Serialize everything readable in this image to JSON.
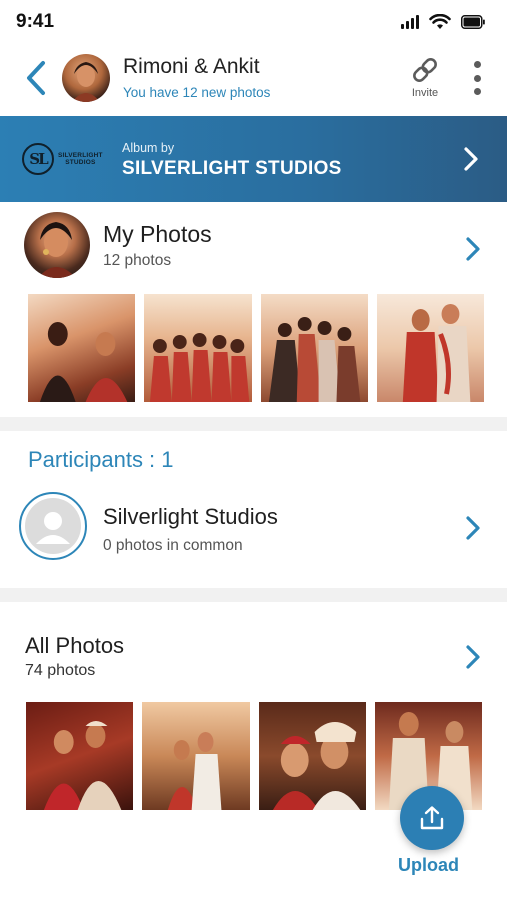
{
  "status_bar": {
    "time": "9:41"
  },
  "header": {
    "title": "Rimoni & Ankit",
    "subtitle": "You have 12 new photos",
    "invite_label": "Invite"
  },
  "album_banner": {
    "logo_text_line1": "SILVERLIGHT",
    "logo_text_line2": "STUDIOS",
    "album_by_label": "Album by",
    "studio_name": "SILVERLIGHT STUDIOS"
  },
  "my_photos": {
    "title": "My Photos",
    "count": "12 photos"
  },
  "participants": {
    "heading": "Participants : 1",
    "items": [
      {
        "name": "Silverlight Studios",
        "common": "0 photos in common"
      }
    ]
  },
  "all_photos": {
    "title": "All Photos",
    "count": "74 photos"
  },
  "upload": {
    "label": "Upload"
  },
  "colors": {
    "accent": "#2d86b8",
    "banner": "#2c7fb4",
    "divider": "#f1f1f1"
  }
}
